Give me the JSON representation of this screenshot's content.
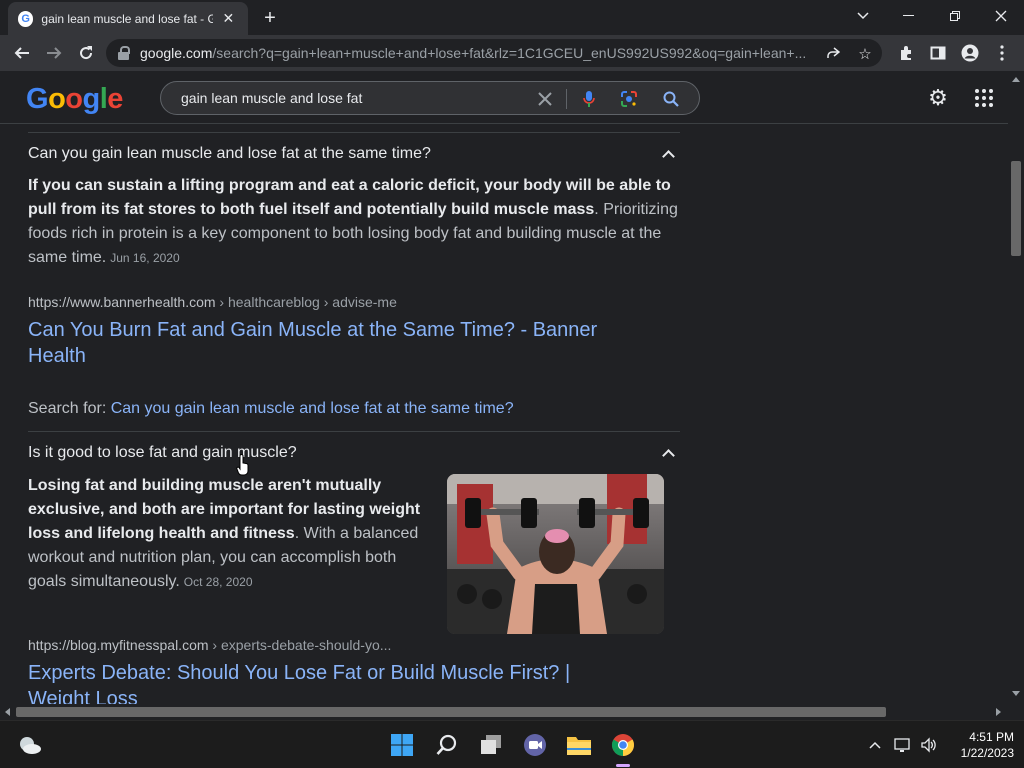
{
  "browser": {
    "tab_title": "gain lean muscle and lose fat - G",
    "tab_favicon": "G",
    "url_host": "google.com",
    "url_path": "/search?q=gain+lean+muscle+and+lose+fat&rlz=1C1GCEU_enUS992US992&oq=gain+lean+...",
    "icons": [
      "close-icon",
      "new-tab-icon",
      "back-icon",
      "forward-icon",
      "reload-icon",
      "lock-icon",
      "share-icon",
      "star-icon",
      "extensions-icon",
      "side-panel-icon",
      "profile-icon",
      "menu-icon"
    ]
  },
  "google": {
    "logo": "Google",
    "search_query": "gain lean muscle and lose fat"
  },
  "results": {
    "q1": {
      "question": "Can you gain lean muscle and lose fat at the same time?",
      "answer_bold": "If you can sustain a lifting program and eat a caloric deficit, your body will be able to pull from its fat stores to both fuel itself and potentially build muscle mass",
      "answer_rest": ". Prioritizing foods rich in protein is a key component to both losing body fat and building muscle at the same time.",
      "date": "Jun 16, 2020",
      "cite_host": "https://www.bannerhealth.com",
      "cite_path": " › healthcareblog › advise-me",
      "link_title": "Can You Burn Fat and Gain Muscle at the Same Time? - Banner Health",
      "search_for_label": "Search for: ",
      "search_for_link": "Can you gain lean muscle and lose fat at the same time?"
    },
    "q2": {
      "question": "Is it good to lose fat and gain muscle?",
      "answer_bold": "Losing fat and building muscle aren't mutually exclusive, and both are important for lasting weight loss and lifelong health and fitness",
      "answer_rest": ". With a balanced workout and nutrition plan, you can accomplish both goals simultaneously.",
      "date": "Oct 28, 2020",
      "cite_host": "https://blog.myfitnesspal.com",
      "cite_path": " › experts-debate-should-yo...",
      "link_title": "Experts Debate: Should You Lose Fat or Build Muscle First? | Weight Loss"
    }
  },
  "taskbar": {
    "time": "4:51 PM",
    "date": "1/22/2023",
    "apps": [
      "weather-icon",
      "windows-start-icon",
      "search-icon",
      "task-view-icon",
      "teams-icon",
      "file-explorer-icon",
      "chrome-icon"
    ]
  },
  "colors": {
    "page_bg": "#202124",
    "link": "#8ab4f8",
    "text": "#bdc1c6",
    "heading": "#e8eaed"
  }
}
